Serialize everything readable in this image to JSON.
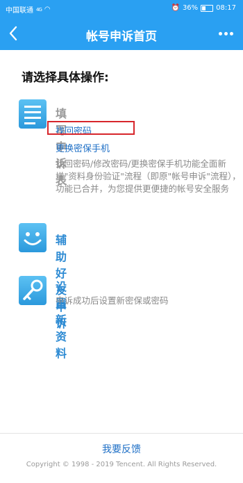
{
  "status_bar": {
    "carrier": "中国联通",
    "signal": "4G",
    "battery": "36%",
    "time": "08:17"
  },
  "nav": {
    "title": "帐号申诉首页"
  },
  "heading": "请选择具体操作:",
  "sections": [
    {
      "title": "填写申诉表",
      "links": [
        "找回密码",
        "更换密保手机"
      ],
      "description": "找回密码/修改密码/更换密保手机功能全面新增\"资料身份验证\"流程（即原\"帐号申诉\"流程），功能已合并，为您提供更便捷的帐号安全服务",
      "icon": "form-list-icon"
    },
    {
      "title": "辅助好友申诉",
      "icon": "smile-face-icon"
    },
    {
      "title": "设置新资料",
      "description": "申诉成功后设置新密保或密码",
      "icon": "key-icon"
    }
  ],
  "footer": {
    "feedback": "我要反馈",
    "copyright": "Copyright © 1998 - 2019 Tencent. All Rights Reserved."
  },
  "colors": {
    "primary": "#2aa0f2",
    "link": "#1e6fc6",
    "highlight_border": "#d7252b"
  }
}
